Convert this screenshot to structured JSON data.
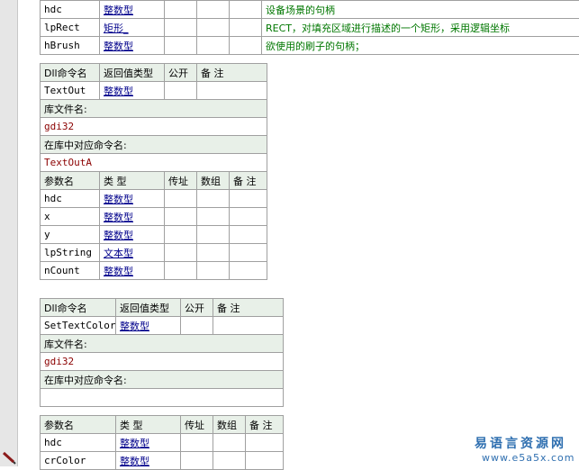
{
  "table1": {
    "rows": [
      {
        "name": "hdc",
        "type": "整数型",
        "note": "设备场景的句柄"
      },
      {
        "name": "lpRect",
        "type": "矩形_",
        "note": "RECT，对填充区域进行描述的一个矩形，采用逻辑坐标"
      },
      {
        "name": "hBrush",
        "type": "整数型",
        "note": "欲使用的刷子的句柄；"
      }
    ]
  },
  "table2": {
    "header": {
      "dll": "Dll命令名",
      "ret": "返回值类型",
      "pub": "公开",
      "note": "备 注"
    },
    "dll_row": {
      "name": "TextOut",
      "ret": "整数型"
    },
    "lib_label": "库文件名:",
    "lib_value": "gdi32",
    "alias_label": "在库中对应命令名:",
    "alias_value": "TextOutA",
    "param_header": {
      "name": "参数名",
      "type": "类 型",
      "ref": "传址",
      "arr": "数组",
      "note": "备 注"
    },
    "params": [
      {
        "name": "hdc",
        "type": "整数型"
      },
      {
        "name": "x",
        "type": "整数型"
      },
      {
        "name": "y",
        "type": "整数型"
      },
      {
        "name": "lpString",
        "type": "文本型"
      },
      {
        "name": "nCount",
        "type": "整数型"
      }
    ]
  },
  "table3": {
    "header": {
      "dll": "Dll命令名",
      "ret": "返回值类型",
      "pub": "公开",
      "note": "备 注"
    },
    "dll_row": {
      "name": "SetTextColor",
      "ret": "整数型"
    },
    "lib_label": "库文件名:",
    "lib_value": "gdi32",
    "alias_label": "在库中对应命令名:",
    "alias_value": "",
    "param_header": {
      "name": "参数名",
      "type": "类 型",
      "ref": "传址",
      "arr": "数组",
      "note": "备 注"
    },
    "params": [
      {
        "name": "hdc",
        "type": "整数型"
      },
      {
        "name": "crColor",
        "type": "整数型"
      }
    ]
  },
  "watermark": {
    "line1": "易语言资源网",
    "line2": "www.e5a5x.com"
  }
}
